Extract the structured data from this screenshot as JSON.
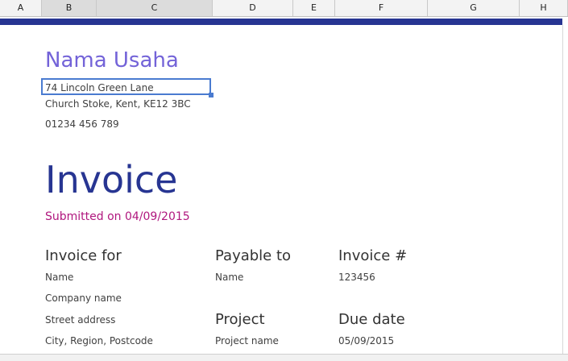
{
  "columns": [
    "A",
    "B",
    "C",
    "D",
    "E",
    "F",
    "G",
    "H"
  ],
  "company": {
    "name": "Nama Usaha",
    "address1": "74 Lincoln Green Lane",
    "address2": "Church Stoke, Kent, KE12 3BC",
    "phone": "01234 456 789"
  },
  "invoice": {
    "title": "Invoice",
    "submitted": "Submitted on 04/09/2015"
  },
  "invoice_for": {
    "heading": "Invoice for",
    "name": "Name",
    "company": "Company name",
    "street": "Street address",
    "city": "City, Region, Postcode"
  },
  "payable_to": {
    "heading": "Payable to",
    "name": "Name"
  },
  "project": {
    "heading": "Project",
    "name": "Project name"
  },
  "invoice_number": {
    "heading": "Invoice #",
    "value": "123456"
  },
  "due_date": {
    "heading": "Due date",
    "value": "05/09/2015"
  },
  "colors": {
    "accent_bar": "#273592",
    "company_name": "#7363d8",
    "submitted": "#b0177e",
    "selection": "#4a7bd0"
  }
}
